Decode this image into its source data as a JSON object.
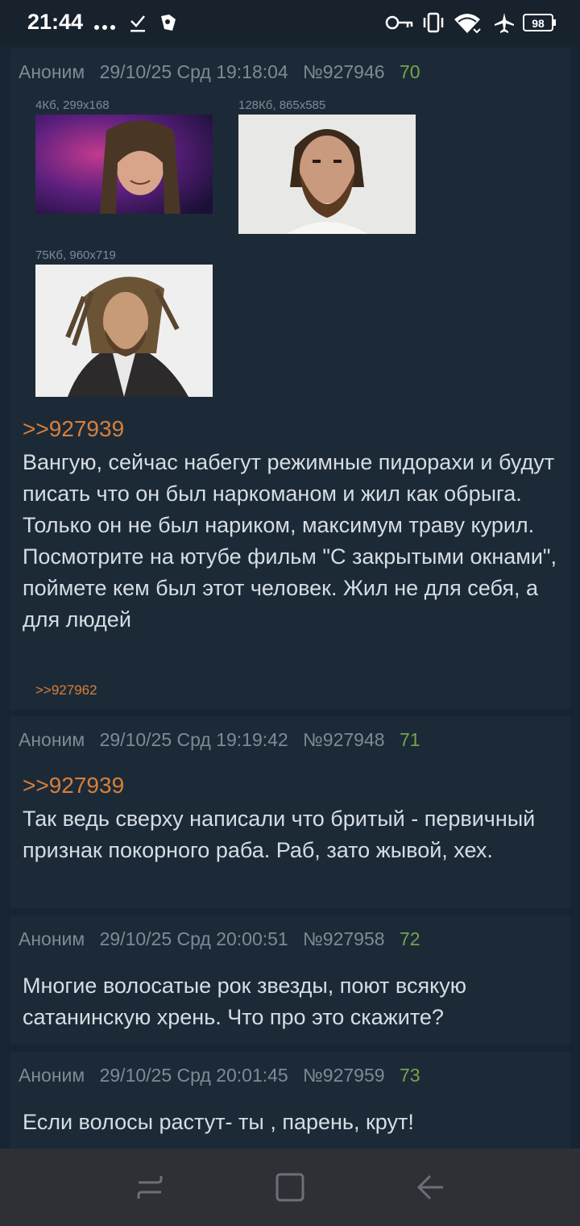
{
  "status_bar": {
    "time": "21:44",
    "battery": "98",
    "icons": [
      "more-dots-icon",
      "download-done-icon",
      "app-notification-icon",
      "key-icon",
      "vibrate-icon",
      "wifi-icon",
      "airplane-icon",
      "battery-icon"
    ]
  },
  "posts": [
    {
      "author": "Аноним",
      "date": "29/10/25 Срд 19:18:04",
      "id": "№927946",
      "index": "70",
      "attachments": [
        {
          "meta": "4Кб, 299x168"
        },
        {
          "meta": "128Кб, 865x585"
        },
        {
          "meta": "75Кб, 960x719"
        }
      ],
      "reply_to": ">>927939",
      "text": "Вангую, сейчас набегут режимные пидорахи и будут писать что он был наркоманом и жил как обрыга. Только он не был нариком, максимум траву курил. Посмотрите на ютубе фильм \"С закрытыми окнами\", поймете кем был этот человек. Жил не для себя, а для людей",
      "backlink": ">>927962"
    },
    {
      "author": "Аноним",
      "date": "29/10/25 Срд 19:19:42",
      "id": "№927948",
      "index": "71",
      "reply_to": ">>927939",
      "text": "Так ведь сверху написали что бритый - первичный признак покорного раба. Раб, зато жывой, хех."
    },
    {
      "author": "Аноним",
      "date": "29/10/25 Срд 20:00:51",
      "id": "№927958",
      "index": "72",
      "text": "Многие волосатые рок звезды, поют всякую сатанинскую хрень. Что про это скажите?"
    },
    {
      "author": "Аноним",
      "date": "29/10/25 Срд 20:01:45",
      "id": "№927959",
      "index": "73",
      "text": "Если волосы растут- ты , парень, крут!"
    }
  ],
  "nav_bar": {
    "icons": [
      "recents-icon",
      "home-icon",
      "back-icon"
    ]
  },
  "colors": {
    "background": "#172431",
    "post_background": "#1c2a38",
    "header_text": "#7e8a96",
    "post_number": "#76a44a",
    "reply_link": "#d97f39",
    "body_text": "#d6dde3"
  }
}
